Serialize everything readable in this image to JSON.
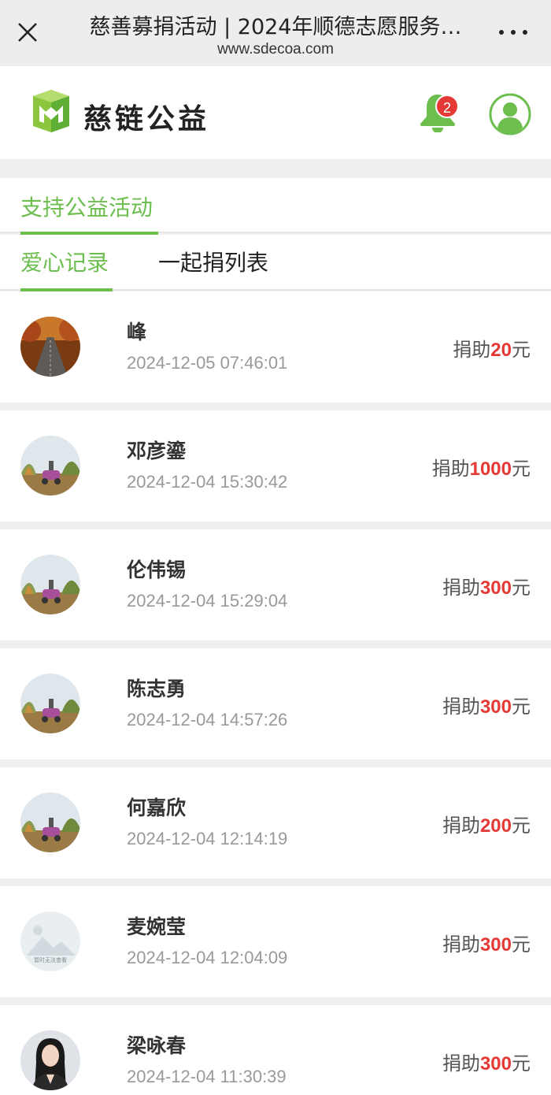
{
  "browser": {
    "title": "慈善募捐活动 | 2024年顺德志愿服务…",
    "url": "www.sdecoa.com"
  },
  "header": {
    "logo_text": "慈链公益",
    "notification_count": "2"
  },
  "section": {
    "title": "支持公益活动"
  },
  "tabs": [
    {
      "label": "爱心记录",
      "active": true
    },
    {
      "label": "一起捐列表",
      "active": false
    }
  ],
  "donation_prefix": "捐助",
  "donation_suffix": "元",
  "donations": [
    {
      "name": "峰",
      "time": "2024-12-05 07:46:01",
      "amount": "20",
      "avatar": "road-photo"
    },
    {
      "name": "邓彦鎏",
      "time": "2024-12-04 15:30:42",
      "amount": "1000",
      "avatar": "scooter-photo"
    },
    {
      "name": "伦伟锡",
      "time": "2024-12-04 15:29:04",
      "amount": "300",
      "avatar": "scooter-photo"
    },
    {
      "name": "陈志勇",
      "time": "2024-12-04 14:57:26",
      "amount": "300",
      "avatar": "scooter-photo"
    },
    {
      "name": "何嘉欣",
      "time": "2024-12-04 12:14:19",
      "amount": "200",
      "avatar": "scooter-photo"
    },
    {
      "name": "麦婉莹",
      "time": "2024-12-04 12:04:09",
      "amount": "300",
      "avatar": "placeholder-image",
      "avatar_text": "暂时无法查看"
    },
    {
      "name": "梁咏春",
      "time": "2024-12-04 11:30:39",
      "amount": "300",
      "avatar": "portrait-photo"
    }
  ],
  "colors": {
    "accent": "#6cbf4f",
    "amount": "#e53935"
  }
}
